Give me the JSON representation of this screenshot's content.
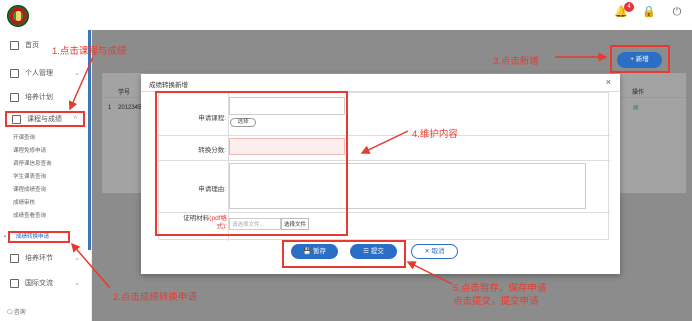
{
  "header": {
    "notification_count": "4",
    "icons": [
      "bell-icon",
      "lock-icon",
      "power-icon"
    ]
  },
  "sidebar": {
    "items": [
      {
        "label": "首页",
        "icon": "home-icon"
      },
      {
        "label": "个人管理",
        "icon": "user-icon"
      },
      {
        "label": "培养计划",
        "icon": "chart-icon"
      },
      {
        "label": "课程与成绩",
        "icon": "chart-icon"
      },
      {
        "label": "培养环节",
        "icon": "chart-icon"
      },
      {
        "label": "国际交流",
        "icon": "chart-icon"
      }
    ],
    "sub_items": [
      "开课查询",
      "课程免修申请",
      "调停课信息查询",
      "学生课表查询",
      "课程成绩查询",
      "成绩审核",
      "成绩查看查询"
    ],
    "active_sub": "成绩转换申请",
    "footer": "咨询"
  },
  "background": {
    "add_button": "+ 新增",
    "col_id": "学号",
    "col_action": "操作",
    "row_num": "1",
    "row_id": "2012345"
  },
  "modal": {
    "title": "成绩转换新增",
    "close": "×",
    "fields": {
      "course_label": "申请课程:",
      "course_pick": "选择",
      "score_label": "转换分数:",
      "reason_label": "申请理由:",
      "file_label_a": "证明材料",
      "file_label_b": "(pdf格",
      "file_label_c": "式):",
      "file_placeholder": "请选择文件...",
      "file_button": "选择文件"
    },
    "buttons": {
      "save": "暂存",
      "submit": "提交",
      "cancel": "取消"
    }
  },
  "annotations": {
    "a1": "1.点击课程与成绩",
    "a2": "2.点击成绩转换申请",
    "a3": "3.点击新增",
    "a4": "4.维护内容",
    "a5_line1": "5.点击暂存，保存申请",
    "a5_line2": "点击提交，提交申请"
  },
  "colors": {
    "accent": "#2a6fc5",
    "annotation": "#e83a2e"
  }
}
